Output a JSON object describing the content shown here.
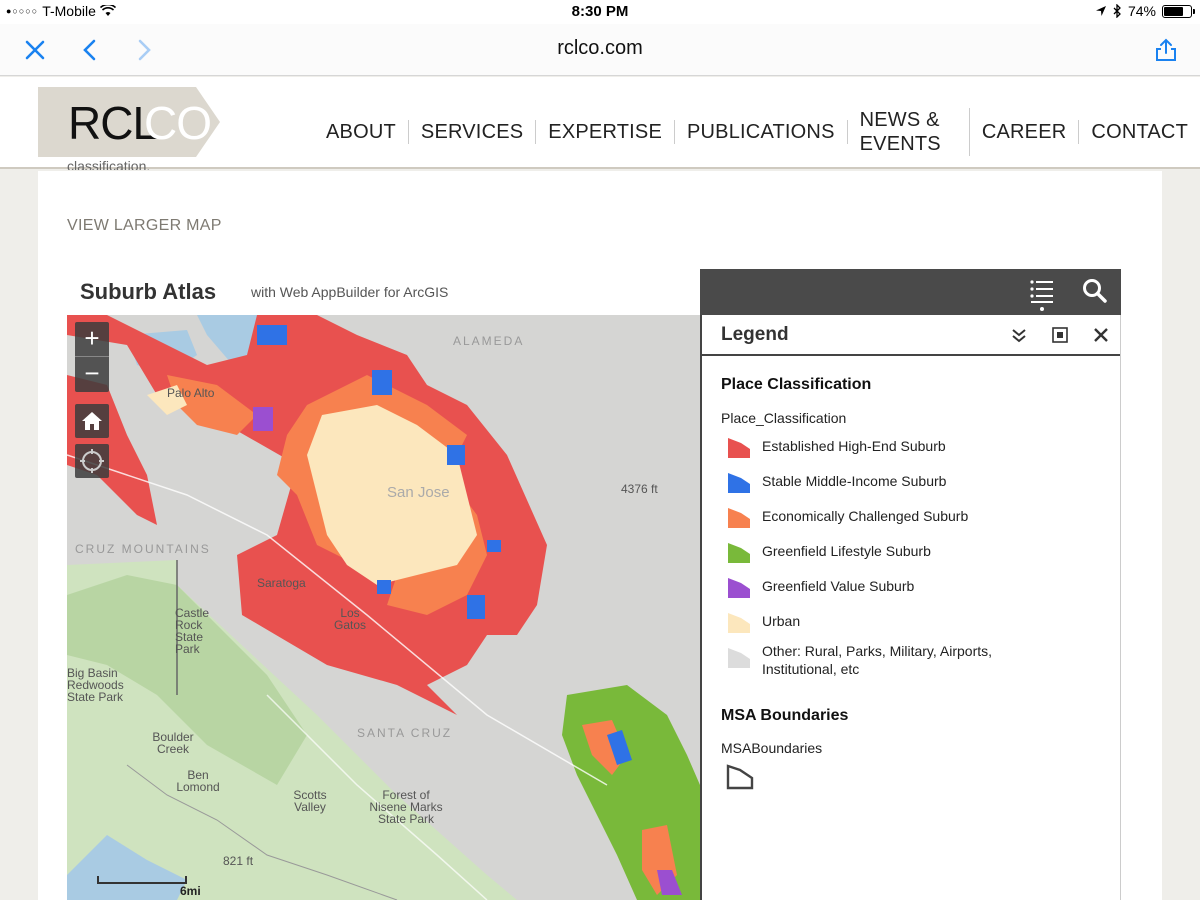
{
  "status_bar": {
    "carrier": "T-Mobile",
    "time": "8:30 PM",
    "battery": "74%",
    "battery_level": 0.74
  },
  "browser": {
    "url": "rclco.com"
  },
  "site": {
    "logo_text": "RCLCO",
    "nav": [
      "ABOUT",
      "SERVICES",
      "EXPERTISE",
      "PUBLICATIONS",
      "NEWS & EVENTS",
      "CAREER",
      "CONTACT"
    ],
    "clipped_text": "classification.",
    "view_larger_map": "VIEW LARGER MAP"
  },
  "app": {
    "title": "Suburb Atlas",
    "subtitle": "with Web AppBuilder for ArcGIS"
  },
  "map": {
    "scale_label": "6mi",
    "labels": [
      "Palo Alto",
      "San Jose",
      "Saratoga",
      "Los Gatos",
      "Castle Rock State Park",
      "Big Basin Redwoods State Park",
      "Boulder Creek",
      "Ben Lomond",
      "Scotts Valley",
      "Forest of Nisene Marks State Park",
      "SANTA CRUZ",
      "CRUZ MOUNTAINS",
      "ALAMEDA",
      "821 ft",
      "4376 ft"
    ]
  },
  "legend": {
    "title": "Legend",
    "section1_title": "Place Classification",
    "section1_field": "Place_Classification",
    "items": [
      {
        "label": "Established High-End Suburb",
        "color": "#e8514f"
      },
      {
        "label": "Stable Middle-Income Suburb",
        "color": "#2f72e6"
      },
      {
        "label": "Economically Challenged Suburb",
        "color": "#f7814f"
      },
      {
        "label": "Greenfield Lifestyle Suburb",
        "color": "#79b93a"
      },
      {
        "label": "Greenfield Value Suburb",
        "color": "#9b4fd0"
      },
      {
        "label": "Urban",
        "color": "#fce7bd"
      },
      {
        "label": "Other: Rural, Parks, Military, Airports, Institutional, etc",
        "color": "#dcdcdc"
      }
    ],
    "section2_title": "MSA Boundaries",
    "section2_field": "MSABoundaries"
  }
}
